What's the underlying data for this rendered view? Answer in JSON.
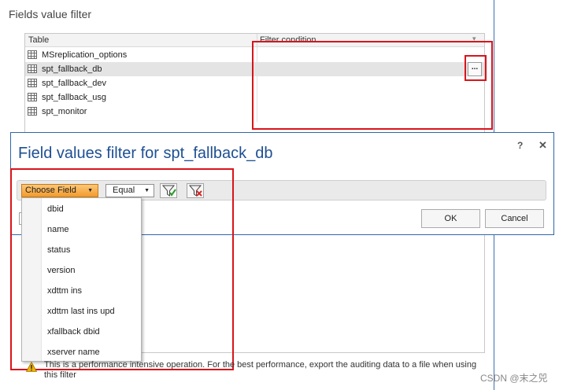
{
  "section": {
    "title": "Fields value filter"
  },
  "grid": {
    "columns": [
      "Table",
      "Filter condition"
    ],
    "rows": [
      {
        "label": "MSreplication_options",
        "selected": false
      },
      {
        "label": "spt_fallback_db",
        "selected": true
      },
      {
        "label": "spt_fallback_dev",
        "selected": false
      },
      {
        "label": "spt_fallback_usg",
        "selected": false
      },
      {
        "label": "spt_monitor",
        "selected": false
      }
    ],
    "ellipsis_label": "..."
  },
  "dialog": {
    "title": "Field values filter for spt_fallback_db",
    "help_label": "?",
    "close_label": "✕",
    "choose_field_label": "Choose Field",
    "operator_value": "Equal",
    "ok_label": "OK",
    "cancel_label": "Cancel"
  },
  "dropdown": {
    "items": [
      "dbid",
      "name",
      "status",
      "version",
      "xdttm ins",
      "xdttm last ins upd",
      "xfallback dbid",
      "xserver name"
    ]
  },
  "warning": {
    "text": "This is a performance intensive operation. For the best performance, export the auditing data to a file when using this filter"
  },
  "watermark": "CSDN @末之兕",
  "colors": {
    "accent": "#1e4f93",
    "highlight_red": "#d9141b",
    "choose_button": "#f39a2c"
  },
  "icons": {
    "table": "table-icon",
    "add_filter": "filter-add-icon",
    "remove_filter": "filter-remove-icon",
    "warning": "warning-icon"
  }
}
